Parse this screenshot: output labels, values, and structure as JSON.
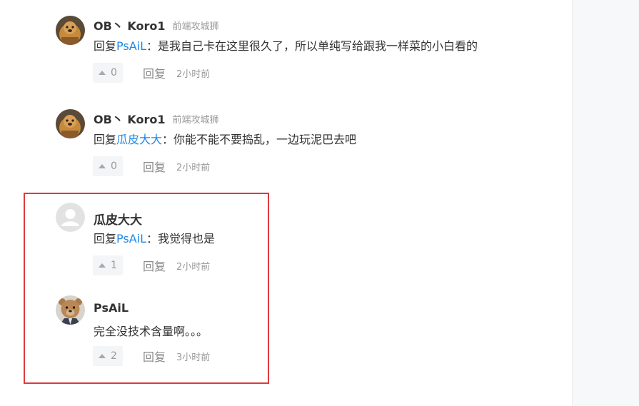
{
  "comments": [
    {
      "author": "OB丶 Koro1",
      "title": "前端攻城狮",
      "reply_prefix": "回复",
      "mention": "PsAiL",
      "text": "：是我自己卡在这里很久了，所以单纯写给跟我一样菜的小白看的",
      "likes": "0",
      "reply_label": "回复",
      "time": "2小时前",
      "avatar_icon": "dog-avatar-icon"
    },
    {
      "author": "OB丶 Koro1",
      "title": "前端攻城狮",
      "reply_prefix": "回复",
      "mention": "瓜皮大大",
      "text": "：你能不能不要捣乱，一边玩泥巴去吧",
      "likes": "0",
      "reply_label": "回复",
      "time": "2小时前",
      "avatar_icon": "dog-avatar-icon"
    },
    {
      "author": "瓜皮大大",
      "title": "",
      "reply_prefix": "回复",
      "mention": "PsAiL",
      "text": "：我觉得也是",
      "likes": "1",
      "reply_label": "回复",
      "time": "2小时前",
      "avatar_icon": "default-user-avatar-icon"
    },
    {
      "author": "PsAiL",
      "title": "",
      "reply_prefix": "",
      "mention": "",
      "text": "完全没技术含量啊。。。",
      "likes": "2",
      "reply_label": "回复",
      "time": "3小时前",
      "avatar_icon": "teddy-bear-avatar-icon"
    }
  ],
  "colors": {
    "highlight_border": "#e0393e",
    "mention": "#1e88e5",
    "sidebar_bg": "#f7f8fa"
  }
}
